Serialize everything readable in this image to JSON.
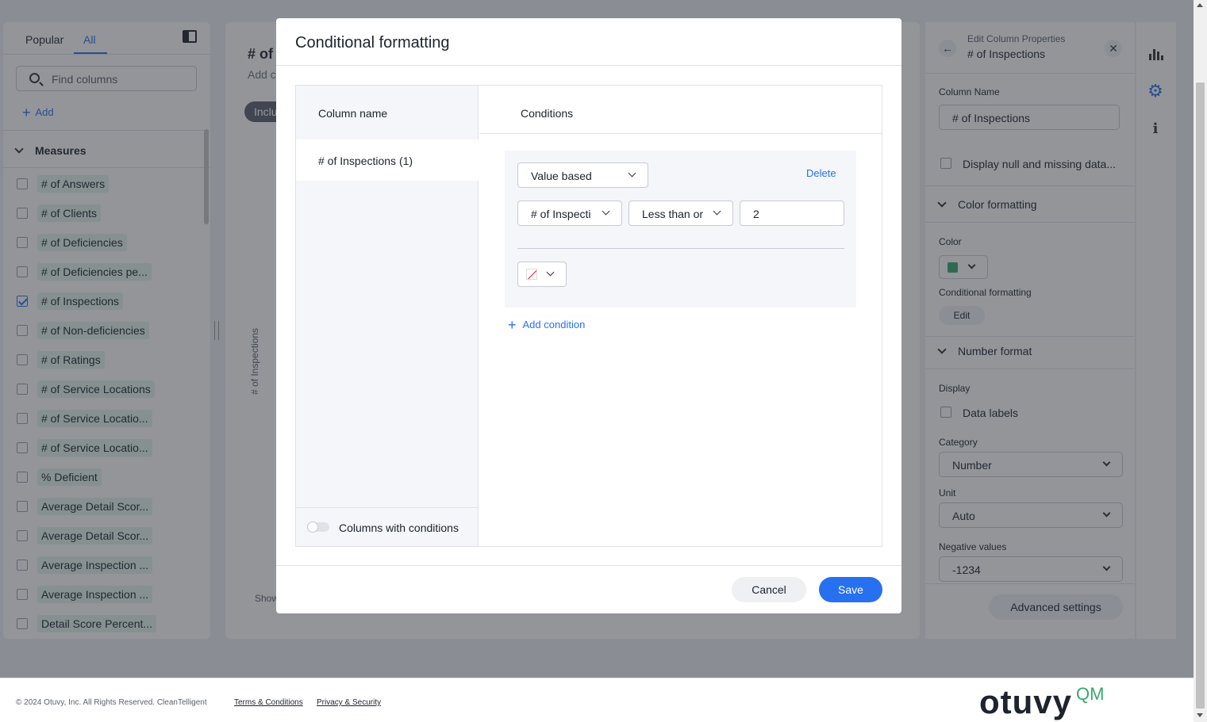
{
  "left_panel": {
    "tabs": [
      {
        "label": "Popular"
      },
      {
        "label": "All"
      }
    ],
    "search_placeholder": "Find columns",
    "add_label": "Add",
    "section": "Measures",
    "columns": [
      {
        "label": "# of Answers",
        "checked": false
      },
      {
        "label": "# of Clients",
        "checked": false
      },
      {
        "label": "# of Deficiencies",
        "checked": false
      },
      {
        "label": "# of Deficiencies pe...",
        "checked": false
      },
      {
        "label": "# of Inspections",
        "checked": true
      },
      {
        "label": "# of Non-deficiencies",
        "checked": false
      },
      {
        "label": "# of Ratings",
        "checked": false
      },
      {
        "label": "# of Service Locations",
        "checked": false
      },
      {
        "label": "# of Service Locatio...",
        "checked": false
      },
      {
        "label": "# of Service Locatio...",
        "checked": false
      },
      {
        "label": "% Deficient",
        "checked": false
      },
      {
        "label": "Average Detail Scor...",
        "checked": false
      },
      {
        "label": "Average Detail Scor...",
        "checked": false
      },
      {
        "label": "Average Inspection ...",
        "checked": false
      },
      {
        "label": "Average Inspection ...",
        "checked": false
      },
      {
        "label": "Detail Score Percent...",
        "checked": false
      }
    ]
  },
  "center": {
    "title": "# of",
    "subtitle": "Add c",
    "chip": "Inclu",
    "axis_label": "# of Inspections",
    "show_label": "Show"
  },
  "right_panel": {
    "eyebrow": "Edit Column Properties",
    "title": "# of Inspections",
    "column_name_label": "Column Name",
    "column_name_value": "# of Inspections",
    "display_null_label": "Display null and missing data...",
    "color_formatting_label": "Color formatting",
    "color_label": "Color",
    "color_value": "#3aa76d",
    "conditional_formatting_label": "Conditional formatting",
    "edit_label": "Edit",
    "number_format_label": "Number format",
    "display_label": "Display",
    "data_labels_label": "Data labels",
    "category_label": "Category",
    "category_value": "Number",
    "unit_label": "Unit",
    "unit_value": "Auto",
    "negative_label": "Negative values",
    "negative_value": "-1234",
    "advanced_label": "Advanced settings"
  },
  "modal": {
    "title": "Conditional formatting",
    "column_name_header": "Column name",
    "conditions_header": "Conditions",
    "selected_column": "# of Inspections (1)",
    "columns_toggle_label": "Columns with conditions",
    "rule_type": "Value based",
    "delete_label": "Delete",
    "condition_column": "# of Inspecti",
    "operator": "Less than or",
    "value": "2",
    "add_condition_label": "Add condition",
    "cancel_label": "Cancel",
    "save_label": "Save"
  },
  "footer": {
    "copyright": "© 2024 Otuvy, Inc. All Rights Reserved. CleanTelligent",
    "terms": "Terms & Conditions",
    "privacy": "Privacy & Security",
    "logo": "otuvy",
    "logo_sup": "QM"
  }
}
